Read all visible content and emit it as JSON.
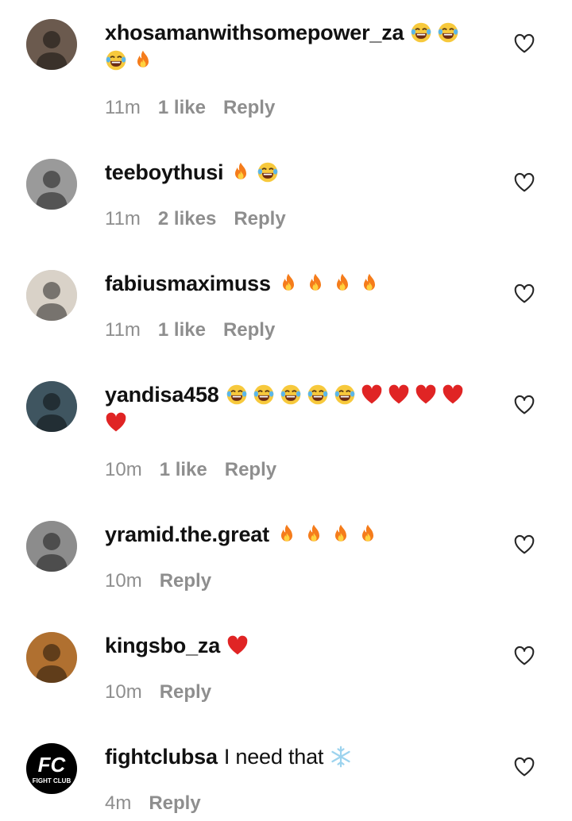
{
  "comments": [
    {
      "username": "xhosamanwithsomepower_za",
      "text": "",
      "emojis": [
        "laugh-cry",
        "laugh-cry",
        "laugh-cry",
        "fire"
      ],
      "time": "11m",
      "likes": "1 like",
      "reply": "Reply",
      "avatar": "user-photo-avatar"
    },
    {
      "username": "teeboythusi",
      "text": "",
      "emojis": [
        "fire",
        "laugh-cry"
      ],
      "time": "11m",
      "likes": "2 likes",
      "reply": "Reply",
      "avatar": "user-photo-avatar"
    },
    {
      "username": "fabiusmaximuss",
      "text": "",
      "emojis": [
        "fire",
        "fire",
        "fire",
        "fire"
      ],
      "time": "11m",
      "likes": "1 like",
      "reply": "Reply",
      "avatar": "user-photo-avatar"
    },
    {
      "username": "yandisa458",
      "text": "",
      "emojis": [
        "laugh-cry",
        "laugh-cry",
        "laugh-cry",
        "laugh-cry",
        "laugh-cry",
        "red-heart",
        "red-heart",
        "red-heart",
        "red-heart",
        "red-heart"
      ],
      "time": "10m",
      "likes": "1 like",
      "reply": "Reply",
      "avatar": "user-photo-avatar"
    },
    {
      "username": "yramid.the.great",
      "text": "",
      "emojis": [
        "fire",
        "fire",
        "fire",
        "fire"
      ],
      "time": "10m",
      "likes": "",
      "reply": "Reply",
      "avatar": "user-photo-avatar"
    },
    {
      "username": "kingsbo_za",
      "text": "",
      "emojis": [
        "red-heart"
      ],
      "time": "10m",
      "likes": "",
      "reply": "Reply",
      "avatar": "user-photo-avatar"
    },
    {
      "username": "fightclubsa",
      "text": "I need that",
      "emojis": [
        "snowflake"
      ],
      "time": "4m",
      "likes": "",
      "reply": "Reply",
      "avatar": "fight-club-logo",
      "logo_text": "FC",
      "logo_subtext": "FIGHT CLUB"
    }
  ],
  "colors": {
    "meta_gray": "#8e8e8e",
    "heart_red": "#e02424",
    "fire_orange": "#f5a21b",
    "emoji_yellow": "#f7c93c"
  }
}
